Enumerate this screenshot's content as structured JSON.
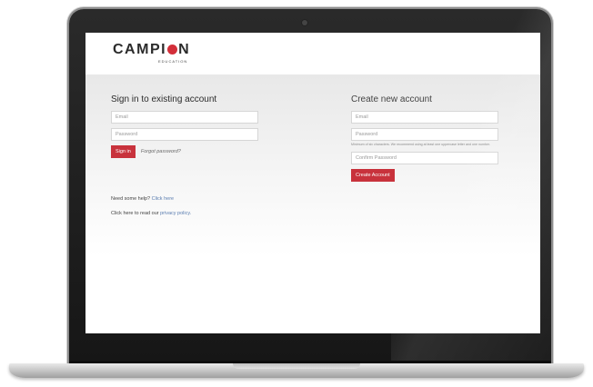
{
  "brand": {
    "logo_before": "CAMPI",
    "logo_after": "N",
    "logo_sub": "EDUCATION"
  },
  "signin": {
    "title": "Sign in to existing account",
    "email_placeholder": "Email",
    "password_placeholder": "Password",
    "submit_label": "Sign in",
    "forgot_label": "Forgot password?"
  },
  "register": {
    "title": "Create new account",
    "email_placeholder": "Email",
    "password_placeholder": "Password",
    "password_hint": "Minimum of six characters. We recommend using at least one uppercase letter and one number.",
    "confirm_placeholder": "Confirm Password",
    "submit_label": "Create Account"
  },
  "help": {
    "prefix": "Need some help? ",
    "link": "Click here"
  },
  "privacy": {
    "prefix": "Click here to read our ",
    "link": "privacy policy."
  },
  "colors": {
    "accent": "#c8323c",
    "link": "#5a7db0"
  }
}
